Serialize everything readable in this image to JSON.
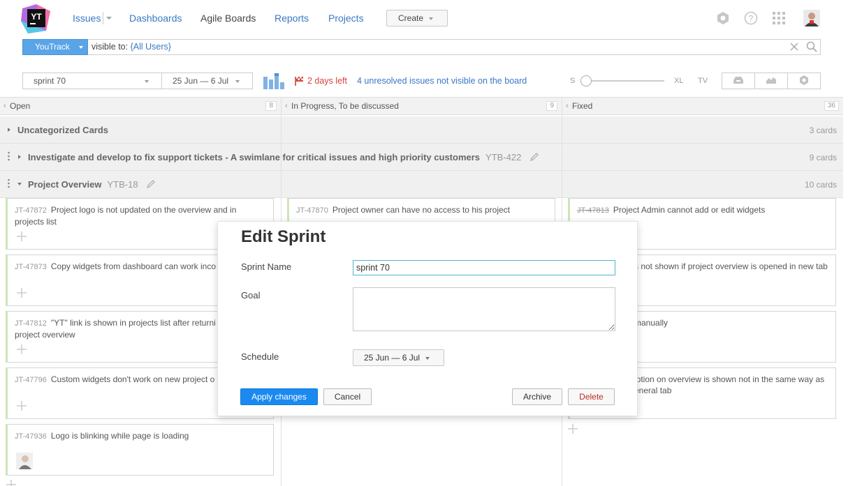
{
  "header": {
    "logo_text": "YT",
    "nav": {
      "issues": "Issues",
      "dashboards": "Dashboards",
      "agile_boards": "Agile Boards",
      "reports": "Reports",
      "projects": "Projects"
    },
    "create_label": "Create",
    "icons": [
      "settings-icon",
      "help-icon",
      "apps-grid-icon",
      "user-avatar"
    ]
  },
  "search": {
    "context_label": "YouTrack",
    "query_prefix": "visible to: ",
    "query_value": "{All Users}"
  },
  "toolbar": {
    "sprint_select": "sprint 70",
    "date_range": "25 Jun — 6 Jul",
    "days_left": "2 days left",
    "unresolved_link": "4 unresolved issues not visible on the board",
    "size_labels": {
      "s": "S",
      "xl": "XL",
      "tv": "TV"
    },
    "card_size_level": 0.0
  },
  "columns": [
    {
      "label": "Open",
      "count": "8"
    },
    {
      "label": "In Progress, To be discussed",
      "count": "9"
    },
    {
      "label": "Fixed",
      "count": "36"
    }
  ],
  "swimlanes": [
    {
      "title": "Uncategorized Cards",
      "id": "",
      "cards": "3 cards"
    },
    {
      "title": "Investigate and develop to fix support tickets - A swimlane for critical issues and high priority customers",
      "id": "YTB-422",
      "cards": "9 cards"
    },
    {
      "title": "Project Overview",
      "id": "YTB-18",
      "cards": "10 cards"
    }
  ],
  "cards": {
    "open": [
      {
        "id": "JT-47872",
        "text": "Project logo is not updated on the overview and in projects list"
      },
      {
        "id": "JT-47873",
        "text": "Copy widgets from dashboard can work inco"
      },
      {
        "id": "JT-47812",
        "text": "\"YT\" link is shown in projects list after returni",
        "text2": "project overview"
      },
      {
        "id": "JT-47796",
        "text": "Custom widgets don't work on new project o"
      },
      {
        "id": "JT-47936",
        "text": "Logo is blinking while page is loading"
      }
    ],
    "progress": [
      {
        "id": "JT-47870",
        "text": "Project owner can have no access to his project"
      }
    ],
    "fixed": [
      {
        "id": "JT-47813",
        "text": "Project Admin cannot add or edit widgets"
      },
      {
        "id": "",
        "text": "s not shown if project overview is opened in new tab"
      },
      {
        "id": "",
        "text": "manually"
      },
      {
        "id": "",
        "text": "iption on overview is shown not in the same way as",
        "text2": "eneral tab"
      }
    ]
  },
  "modal": {
    "title": "Edit Sprint",
    "sprint_name_label": "Sprint Name",
    "sprint_name_value": "sprint 70",
    "goal_label": "Goal",
    "goal_value": "",
    "schedule_label": "Schedule",
    "schedule_value": "25 Jun — 6 Jul",
    "apply": "Apply changes",
    "cancel": "Cancel",
    "archive": "Archive",
    "delete": "Delete"
  },
  "colors": {
    "link": "#3a78c4",
    "accent": "#1a8af0",
    "danger": "#c0281f",
    "days_left": "#d9443a"
  }
}
